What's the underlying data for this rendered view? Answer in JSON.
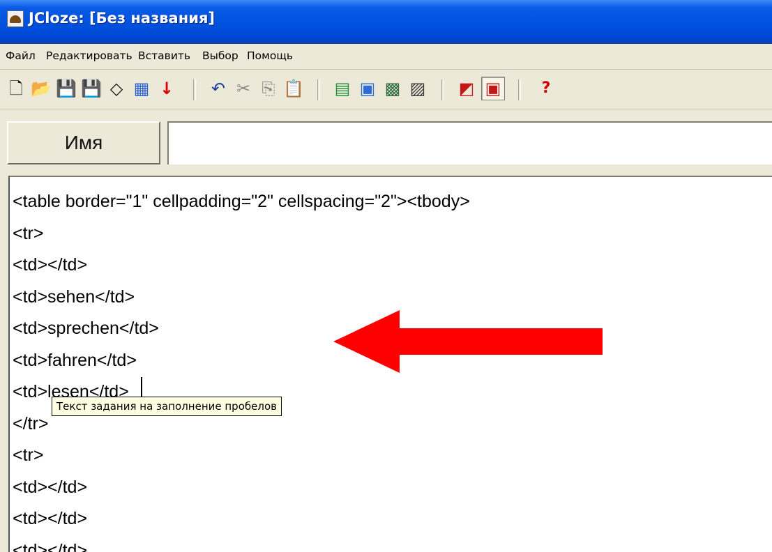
{
  "window": {
    "title": "JCloze: [Без названия]"
  },
  "menu": {
    "items": [
      "Файл",
      "Редактировать",
      "Вставить",
      "Выбор",
      "Помощь"
    ]
  },
  "toolbar": {
    "buttons": [
      {
        "name": "new-file",
        "glyph": "🗋"
      },
      {
        "name": "open-folder",
        "glyph": "📂"
      },
      {
        "name": "save",
        "glyph": "💾"
      },
      {
        "name": "save-as",
        "glyph": "💾"
      },
      {
        "name": "eraser",
        "glyph": "◇"
      },
      {
        "name": "export-web",
        "glyph": "▦"
      },
      {
        "name": "export-arrow",
        "glyph": "↓"
      },
      {
        "name": "undo",
        "glyph": "↶"
      },
      {
        "name": "cut",
        "glyph": "✂"
      },
      {
        "name": "copy",
        "glyph": "⎘"
      },
      {
        "name": "paste",
        "glyph": "📋"
      },
      {
        "name": "web-page",
        "glyph": "▤"
      },
      {
        "name": "window",
        "glyph": "▣"
      },
      {
        "name": "grid-a",
        "glyph": "▩"
      },
      {
        "name": "grid-b",
        "glyph": "▨"
      },
      {
        "name": "colors",
        "glyph": "◩"
      },
      {
        "name": "config",
        "glyph": "▣"
      },
      {
        "name": "help",
        "glyph": "?"
      }
    ]
  },
  "name_field": {
    "label": "Имя",
    "value": ""
  },
  "editor": {
    "lines": [
      "<table border=\"1\" cellpadding=\"2\" cellspacing=\"2\"><tbody>",
      "<tr>",
      "<td></td>",
      "<td>sehen</td>",
      "<td>sprechen</td>",
      "<td>fahren</td>",
      "<td>lesen</td>",
      "</tr>",
      "<tr>",
      "<td></td>",
      "<td></td>",
      "<td></td>"
    ]
  },
  "tooltip": {
    "text": "Текст задания на заполнение пробелов"
  },
  "colors": {
    "arrow": "#ff0000",
    "title_bar": "#0a5ae8",
    "tooltip_bg": "#ffffe1"
  }
}
